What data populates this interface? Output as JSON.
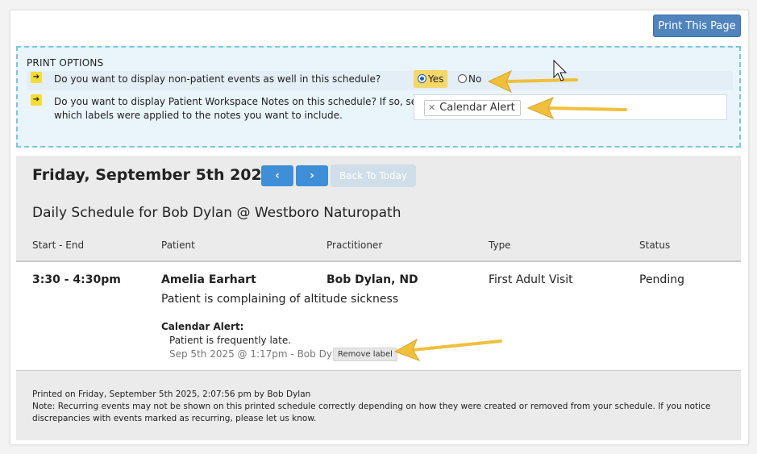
{
  "toolbar": {
    "print_label": "Print This Page"
  },
  "print_options": {
    "title": "PRINT OPTIONS",
    "q1": "Do you want to display non-patient events as well in this schedule?",
    "q1_yes": "Yes",
    "q1_no": "No",
    "q1_selected": "Yes",
    "q2_line1": "Do you want to display Patient Workspace Notes on this schedule? If so, select",
    "q2_line2": "which labels were applied to the notes you want to include.",
    "selected_labels": [
      "Calendar Alert"
    ]
  },
  "schedule": {
    "date": "Friday, September 5th 2025",
    "prev_icon": "‹",
    "next_icon": "›",
    "back_to_today": "Back To Today",
    "title": "Daily Schedule for Bob Dylan @ Westboro Naturopath",
    "columns": [
      "Start - End",
      "Patient",
      "Practitioner",
      "Type",
      "Status"
    ],
    "appointment": {
      "time": "3:30 - 4:30pm",
      "patient": "Amelia Earhart",
      "practitioner": "Bob Dylan, ND",
      "type": "First Adult Visit",
      "status": "Pending",
      "complaint": "Patient is complaining of altitude sickness",
      "note_label": "Calendar Alert:",
      "note_text": "Patient is frequently late.",
      "note_meta": "Sep 5th 2025 @ 1:17pm - Bob Dylan",
      "remove_label": "Remove label"
    },
    "footer": {
      "printed": "Printed on Friday, September 5th 2025, 2:07:56 pm by Bob Dylan",
      "note_line1": "Note: Recurring events may not be shown on this printed schedule correctly depending on how they were created or removed from your schedule. If you notice",
      "note_line2": "discrepancies with events marked as recurring, please let us know."
    }
  },
  "colors": {
    "primary_button": "#4f84bd",
    "nav_button": "#3e8fd8",
    "dashed_border": "#7ec5de",
    "annotation_arrow": "#f0bf3c"
  },
  "icons": {
    "row_badge": "arrow-right-icon",
    "chip_remove": "close-icon",
    "prev": "chevron-left-icon",
    "next": "chevron-right-icon",
    "cursor": "mouse-cursor-icon"
  }
}
